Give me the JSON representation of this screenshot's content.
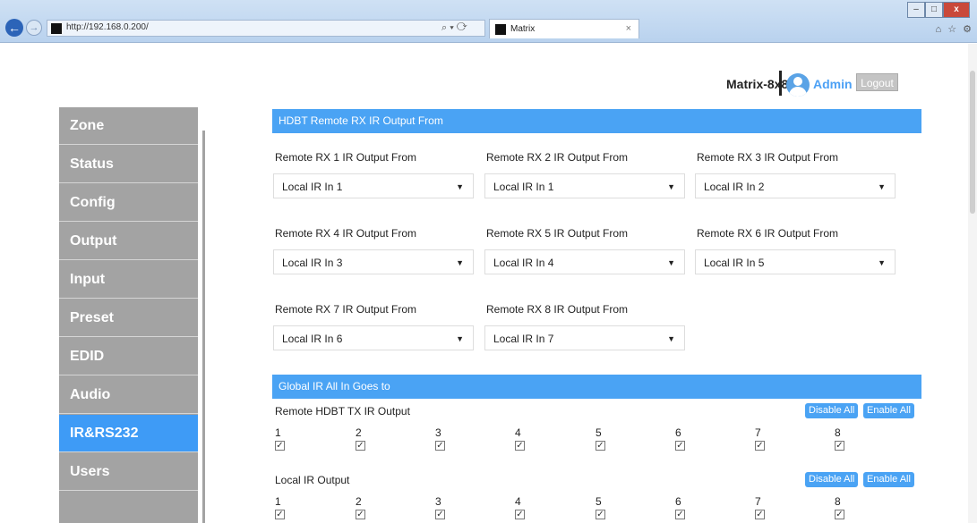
{
  "browser": {
    "url": "http://192.168.0.200/",
    "tab_title": "Matrix",
    "tab_close": "×",
    "search_refresh": "⌕ ▾ ⟳",
    "tools": "⌂ ☆ ⚙"
  },
  "header": {
    "device_name": "Matrix-8x8",
    "user_name": "Admin",
    "logout_label": "Logout"
  },
  "sidebar": {
    "items": [
      {
        "label": "Zone"
      },
      {
        "label": "Status"
      },
      {
        "label": "Config"
      },
      {
        "label": "Output"
      },
      {
        "label": "Input"
      },
      {
        "label": "Preset"
      },
      {
        "label": "EDID"
      },
      {
        "label": "Audio"
      },
      {
        "label": "IR&RS232"
      },
      {
        "label": "Users"
      }
    ],
    "active_index": 8
  },
  "remote_rx": {
    "section_title": "HDBT Remote RX IR Output From",
    "fields": [
      {
        "label": "Remote RX 1 IR Output From",
        "value": "Local IR In 1"
      },
      {
        "label": "Remote RX 2 IR Output From",
        "value": "Local IR In 1"
      },
      {
        "label": "Remote RX 3 IR Output From",
        "value": "Local IR In 2"
      },
      {
        "label": "Remote RX 4 IR Output From",
        "value": "Local IR In 3"
      },
      {
        "label": "Remote RX 5 IR Output From",
        "value": "Local IR In 4"
      },
      {
        "label": "Remote RX 6 IR Output From",
        "value": "Local IR In 5"
      },
      {
        "label": "Remote RX 7 IR Output From",
        "value": "Local IR In 6"
      },
      {
        "label": "Remote RX 8 IR Output From",
        "value": "Local IR In 7"
      }
    ]
  },
  "global_ir": {
    "section_title": "Global IR All In Goes to",
    "groups": [
      {
        "label": "Remote HDBT TX IR Output",
        "disable_label": "Disable All",
        "enable_label": "Enable All",
        "channels": [
          "1",
          "2",
          "3",
          "4",
          "5",
          "6",
          "7",
          "8"
        ],
        "checked": [
          true,
          true,
          true,
          true,
          true,
          true,
          true,
          true
        ]
      },
      {
        "label": "Local IR Output",
        "disable_label": "Disable All",
        "enable_label": "Enable All",
        "channels": [
          "1",
          "2",
          "3",
          "4",
          "5",
          "6",
          "7",
          "8"
        ],
        "checked": [
          true,
          true,
          true,
          true,
          true,
          true,
          true,
          true
        ]
      }
    ]
  },
  "colors": {
    "accent": "#4aa3f4",
    "sidebar_bg": "#a3a3a3",
    "sidebar_active": "#3e9bf6"
  }
}
